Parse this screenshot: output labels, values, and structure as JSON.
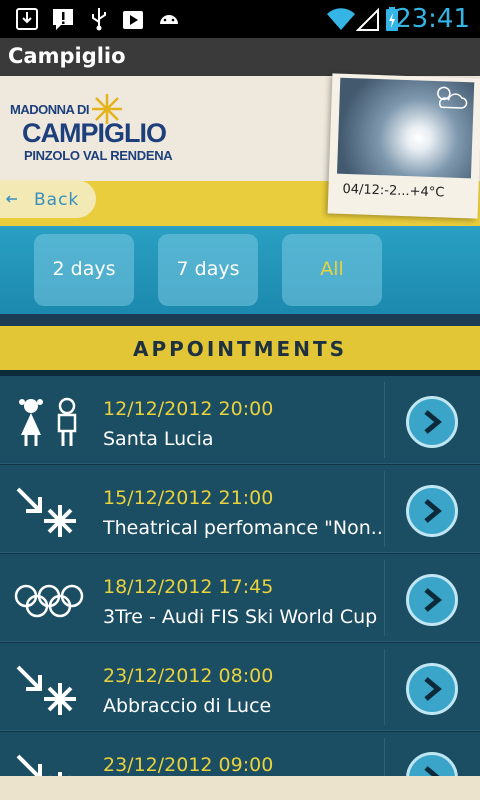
{
  "status_bar": {
    "time": "23:41",
    "icons": [
      "download-icon",
      "alert-icon",
      "usb-icon",
      "play-store-icon",
      "android-icon",
      "wifi-icon",
      "signal-icon",
      "battery-icon"
    ]
  },
  "app": {
    "title": "Campiglio"
  },
  "header": {
    "logo_line1": "MADONNA DI",
    "logo_line2": "CAMPIGLIO",
    "logo_line3": "PINZOLO VAL RENDENA",
    "back_label": "Back",
    "weather_text": "04/12:-2...+4°C"
  },
  "filters": [
    {
      "label": "2 days",
      "active": false
    },
    {
      "label": "7 days",
      "active": false
    },
    {
      "label": "All",
      "active": true
    }
  ],
  "section": {
    "title": "APPOINTMENTS"
  },
  "appointments": [
    {
      "date": "12/12/2012 20:00",
      "name": "Santa Lucia",
      "icon": "children-icon"
    },
    {
      "date": "15/12/2012 21:00",
      "name": "Theatrical perfomance \"Non...",
      "icon": "arrow-snowflake-icon"
    },
    {
      "date": "18/12/2012 17:45",
      "name": "3Tre - Audi FIS Ski World Cup",
      "icon": "olympic-rings-icon"
    },
    {
      "date": "23/12/2012 08:00",
      "name": "Abbraccio di Luce",
      "icon": "arrow-snowflake-icon"
    },
    {
      "date": "23/12/2012 09:00",
      "name": "",
      "icon": "arrow-snowflake-icon"
    }
  ],
  "colors": {
    "accent_yellow": "#e9d23c",
    "accent_blue": "#34b5e5",
    "list_bg": "#1b4d63"
  }
}
